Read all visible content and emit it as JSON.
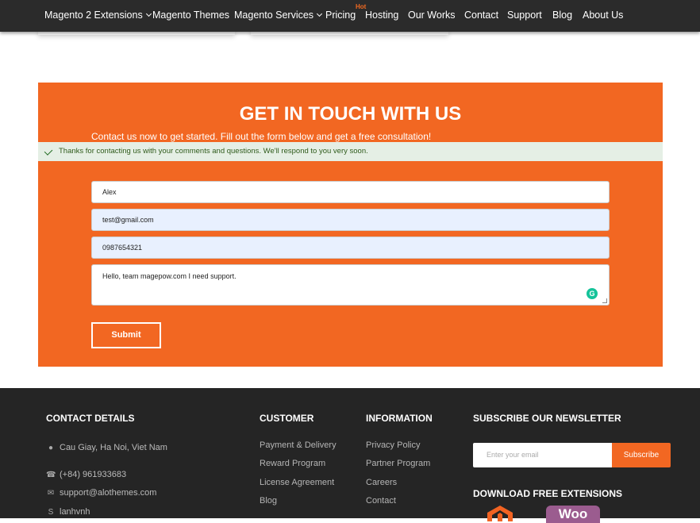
{
  "nav": {
    "items": [
      "Magento 2 Extensions",
      "Magento Themes",
      "Magento Services",
      "Pricing",
      "Hosting",
      "Our Works",
      "Contact",
      "Support",
      "Blog",
      "About Us"
    ],
    "hot_badge": "Hot"
  },
  "contact": {
    "title": "GET IN TOUCH WITH US",
    "subtitle": "Contact us now to get started. Fill out the form below and get a free consultation!",
    "success_message": "Thanks for contacting us with your comments and questions. We'll respond to you very soon.",
    "name_value": "Alex",
    "email_value": "test@gmail.com",
    "phone_value": "0987654321",
    "message_value": "Hello, team magepow.com I need support.",
    "submit_label": "Submit"
  },
  "footer": {
    "contact_title": "CONTACT DETAILS",
    "address": "Cau Giay, Ha Noi, Viet Nam",
    "phone": "(+84) 961933683",
    "email": "support@alothemes.com",
    "skype": "lanhvnh",
    "customer_title": "CUSTOMER",
    "customer_links": [
      "Payment & Delivery",
      "Reward Program",
      "License Agreement",
      "Blog"
    ],
    "information_title": "INFORMATION",
    "information_links": [
      "Privacy Policy",
      "Partner Program",
      "Careers",
      "Contact"
    ],
    "newsletter_title": "SUBSCRIBE OUR NEWSLETTER",
    "newsletter_placeholder": "Enter your email",
    "subscribe_label": "Subscribe",
    "download_title": "DOWNLOAD FREE EXTENSIONS",
    "woo_logo_text": "Woo"
  },
  "colors": {
    "accent": "#f26722",
    "nav_bg": "#2b2b2b",
    "footer_bg": "#252525"
  }
}
